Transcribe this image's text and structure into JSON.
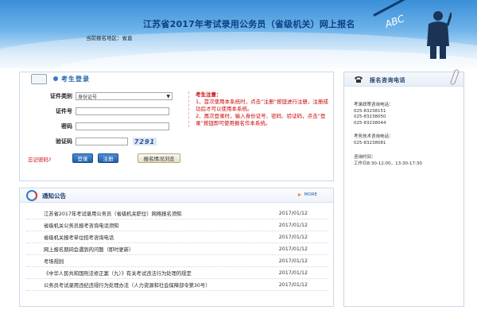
{
  "header": {
    "title": "江苏省2017年考试录用公务员（省级机关）网上报名",
    "region_label": "当前报名地区：",
    "region_value": "省直",
    "scribble": "ABC"
  },
  "login": {
    "title": "考生登录",
    "fields": {
      "id_type_label": "证件类别",
      "id_type_value": "身份证号",
      "id_number_label": "证件号",
      "password_label": "密码",
      "captcha_label": "验证码",
      "captcha_text": "7291"
    },
    "forgot_label": "忘记密码?",
    "login_button": "登录",
    "register_button": "注册",
    "browse_button": "报名情况浏览"
  },
  "notice": {
    "title": "考生注意：",
    "line1": "1、首次使用本系统时，点击“注册”按钮进行注册，注册成功后才可以使用本系统。",
    "line2": "2、再次登录时，输入身份证号、密码、验证码，点击“登录”按钮即可使用报名作本系统。"
  },
  "announcements": {
    "title": "通知公告",
    "more_label": "MORE",
    "items": [
      {
        "title": "江苏省2017年考试录用公务员（省级机关职位）网络报名须知",
        "date": "2017/01/12"
      },
      {
        "title": "省级机关公务员报考咨询电话须知",
        "date": "2017/01/12"
      },
      {
        "title": "省级机关报考单位招考咨询电话",
        "date": "2017/01/12"
      },
      {
        "title": "网上报名期间会遇到的问题（即时更新）",
        "date": "2017/01/12"
      },
      {
        "title": "考场规则",
        "date": "2017/01/12"
      },
      {
        "title": "《中华人民共和国刑法修正案（九）》有关考试违法行为处理的规定",
        "date": "2017/01/12"
      },
      {
        "title": "公务员考试录用违纪违规行为处理办法（人力资源和社会保障部令第30号）",
        "date": "2017/01/12"
      }
    ]
  },
  "contact": {
    "title": "报名咨询电话",
    "policy_label": "考录政策咨询电话：",
    "policy_phones": [
      "025-83238151",
      "025-83238050",
      "025-83238044"
    ],
    "tech_label": "考务技术咨询电话：",
    "tech_phones": [
      "025-83238081"
    ],
    "hours_label": "咨询时间：",
    "hours_value": "工作日8:30-12:00，13:30-17:30"
  },
  "colors": {
    "brand_blue": "#1d5fa8",
    "warning_red": "#cc0000"
  }
}
